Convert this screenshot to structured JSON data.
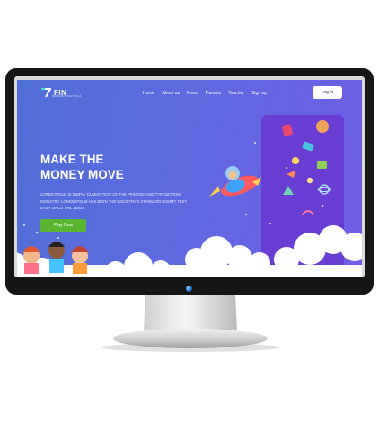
{
  "brand": {
    "name": "FIN",
    "tagline": "BRAIN AND MONEY SKILLS"
  },
  "nav": {
    "items": [
      "Home",
      "About us",
      "Press",
      "Parents",
      "Teacher",
      "Sign up"
    ],
    "login_label": "Log in"
  },
  "hero": {
    "title_line1": "MAKE THE",
    "title_line2": "MONEY MOVE",
    "description": "Lorem Ipsum is simply dummy text of the printing and typesetting industry. Lorem Ipsum has been the industry's standard dummy text ever since the 1500s,",
    "cta_label": "Play Now"
  },
  "colors": {
    "gradient_start": "#4f6fd8",
    "gradient_end": "#6f5de6",
    "panel": "#6d3fd6",
    "cta": "#5cb531"
  },
  "icons": [
    "logo-mark-icon",
    "rocket-icon",
    "monitor-camera-icon"
  ]
}
